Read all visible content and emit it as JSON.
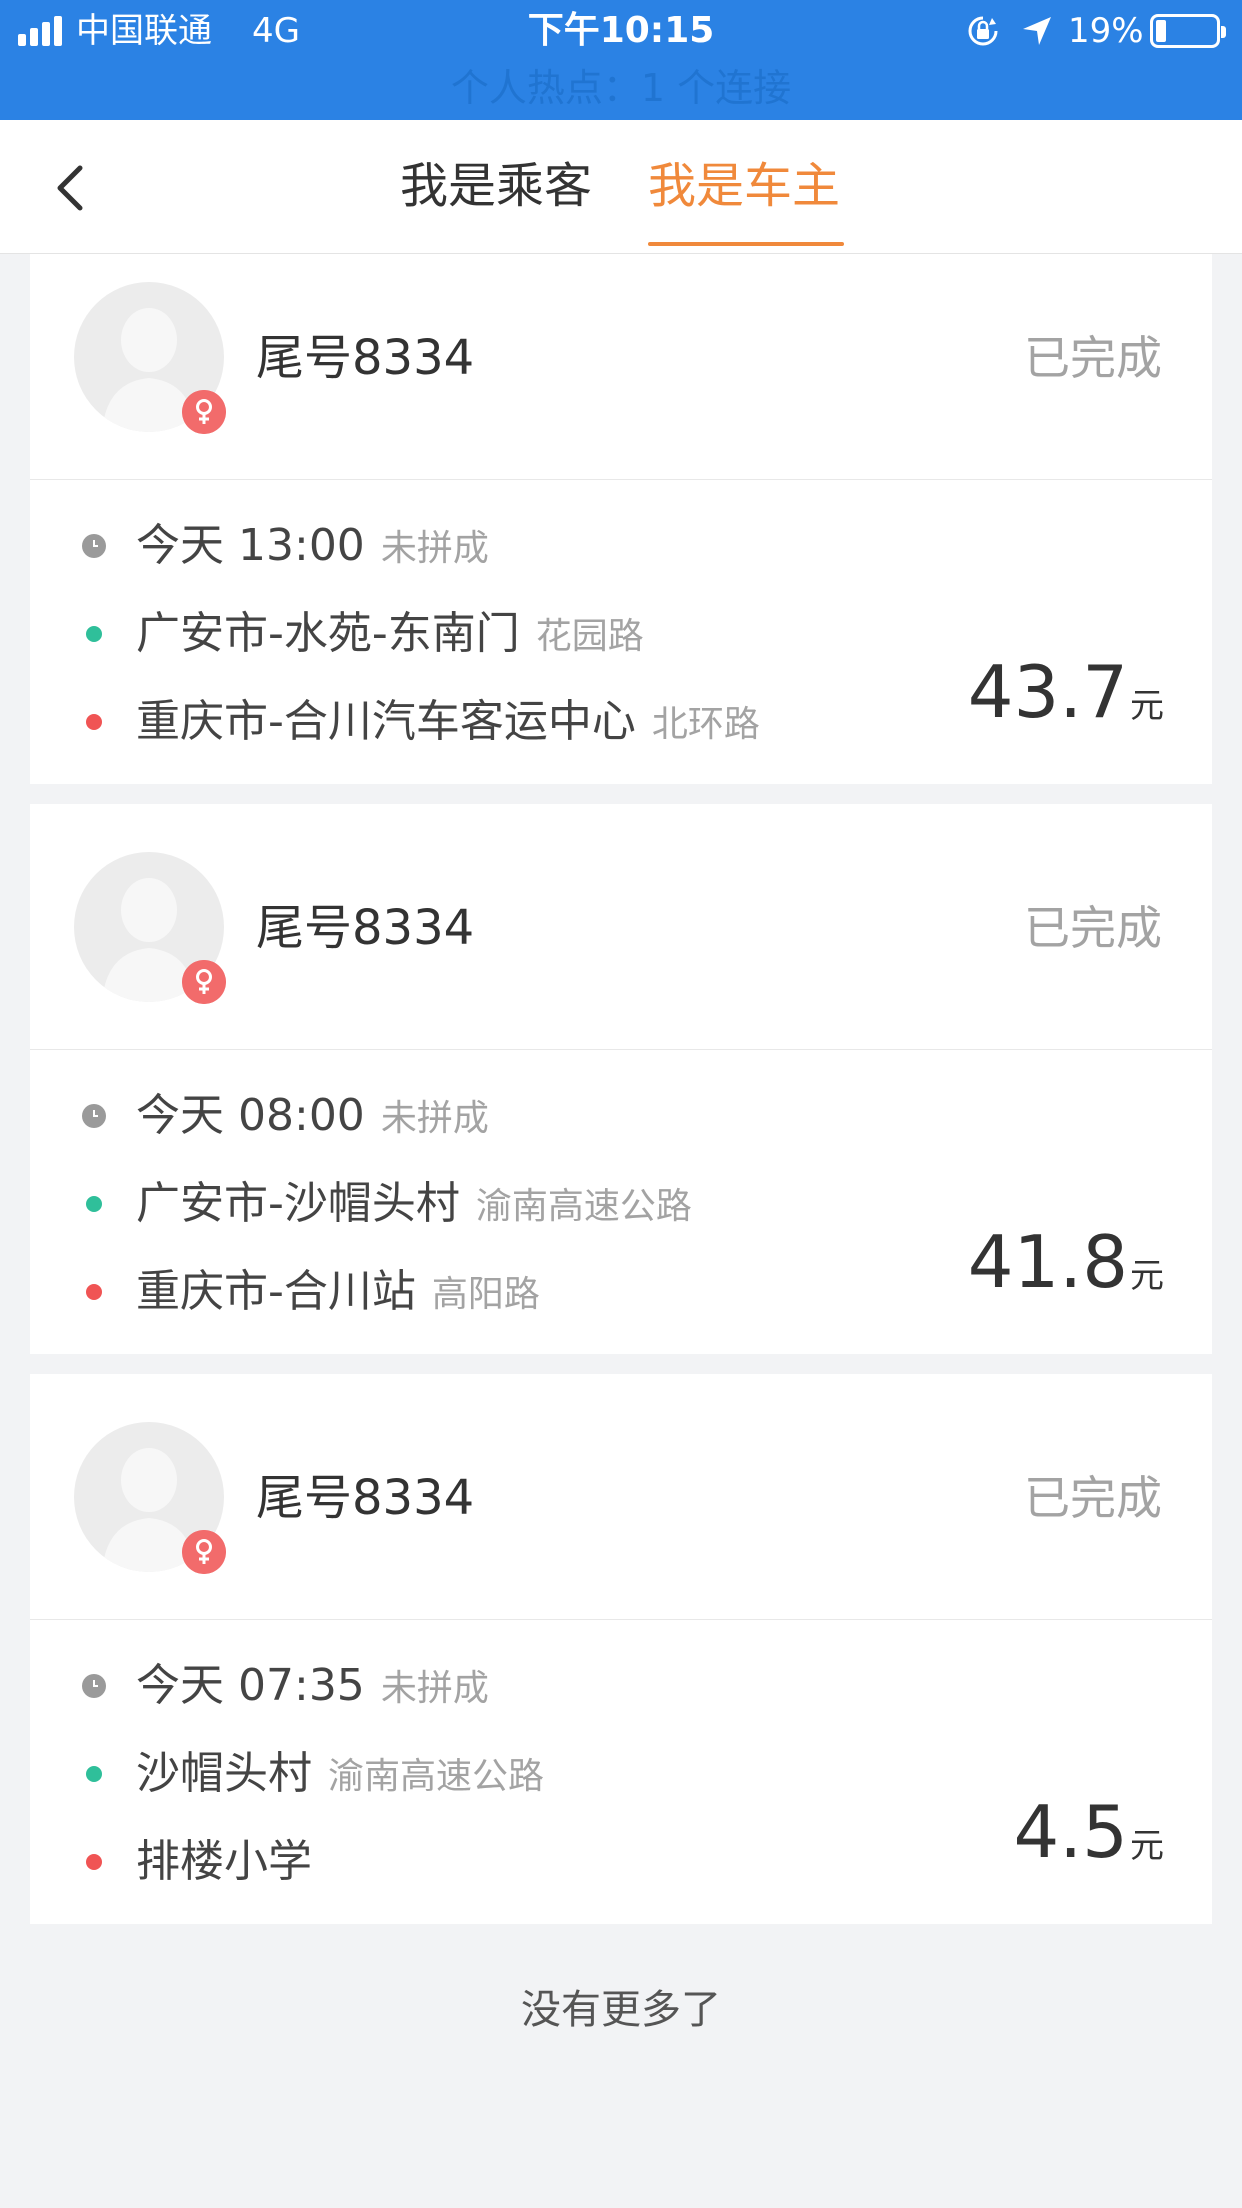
{
  "status_bar": {
    "carrier": "中国联通",
    "network": "4G",
    "time": "下午10:15",
    "battery": "19%",
    "hotspot": "个人热点：1 个连接"
  },
  "nav": {
    "tabs": [
      {
        "label": "我是乘客",
        "active": false
      },
      {
        "label": "我是车主",
        "active": true
      }
    ],
    "accent_color": "#f0893b"
  },
  "orders": [
    {
      "name": "尾号8334",
      "status": "已完成",
      "day": "今天",
      "time": "13:00",
      "time_note": "未拼成",
      "from": "广安市-水苑-东南门",
      "from_sub": "花园路",
      "to": "重庆市-合川汽车客运中心",
      "to_sub": "北环路",
      "price": "43.7",
      "unit": "元"
    },
    {
      "name": "尾号8334",
      "status": "已完成",
      "day": "今天",
      "time": "08:00",
      "time_note": "未拼成",
      "from": "广安市-沙帽头村",
      "from_sub": "渝南高速公路",
      "to": "重庆市-合川站",
      "to_sub": "高阳路",
      "price": "41.8",
      "unit": "元"
    },
    {
      "name": "尾号8334",
      "status": "已完成",
      "day": "今天",
      "time": "07:35",
      "time_note": "未拼成",
      "from": "沙帽头村",
      "from_sub": "渝南高速公路",
      "to": "排楼小学",
      "to_sub": "",
      "price": "4.5",
      "unit": "元"
    }
  ],
  "footer": "没有更多了",
  "icons": {
    "back": "chevron-left-icon",
    "clock": "clock-icon",
    "gender": "female-icon",
    "avatar": "person-silhouette-icon"
  }
}
